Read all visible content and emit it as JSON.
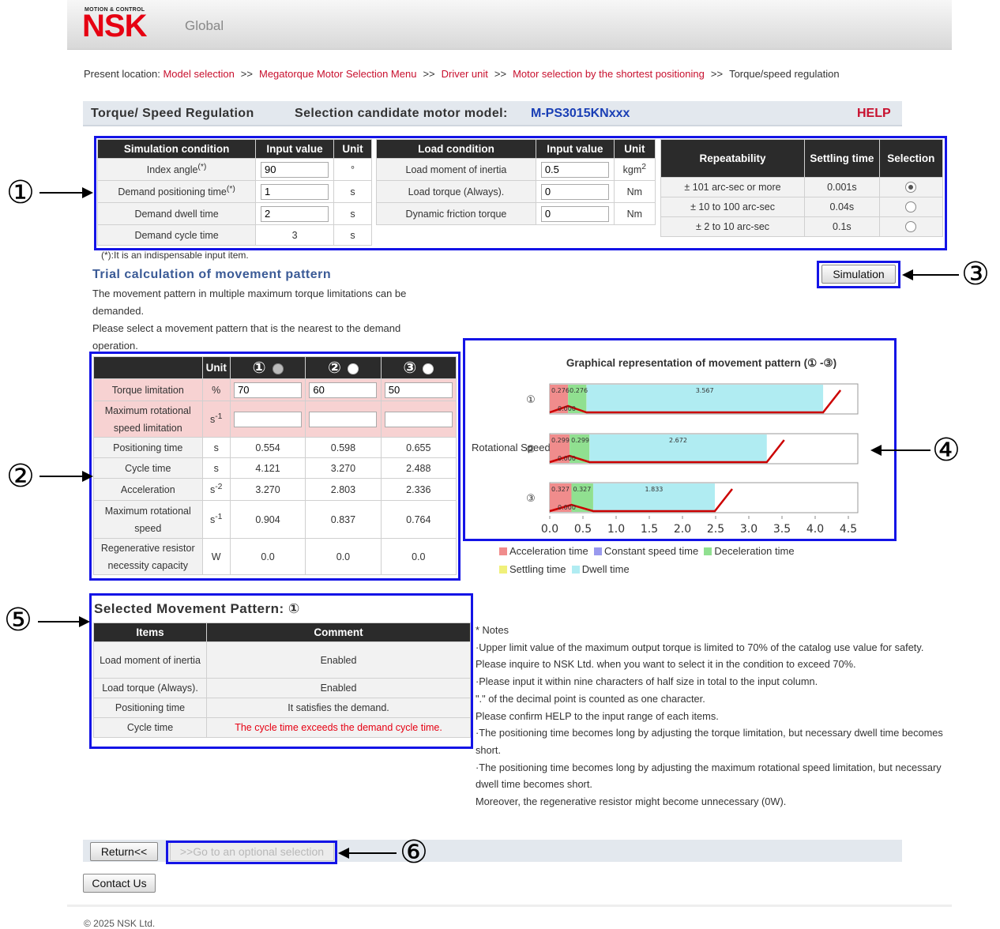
{
  "header": {
    "logo_tagline": "MOTION & CONTROL",
    "logo_text": "NSK",
    "region": "Global"
  },
  "breadcrumb": {
    "prefix": "Present location:",
    "links": [
      "Model selection",
      "Megatorque Motor Selection Menu",
      "Driver unit",
      "Motor selection by the shortest positioning"
    ],
    "separator": ">>",
    "current": "Torque/speed regulation"
  },
  "titlebar": {
    "title": "Torque/ Speed Regulation",
    "candidate_label": "Selection candidate motor model:",
    "candidate_model": "M-PS3015KNxxx",
    "help": "HELP"
  },
  "simulation_condition": {
    "headers": [
      "Simulation condition",
      "Input value",
      "Unit"
    ],
    "rows": [
      {
        "label": "Index angle",
        "mark": "(*)",
        "value": "90",
        "unit": "°",
        "input": true
      },
      {
        "label": "Demand positioning time",
        "mark": "(*)",
        "value": "1",
        "unit": "s",
        "input": true
      },
      {
        "label": "Demand dwell time",
        "mark": "",
        "value": "2",
        "unit": "s",
        "input": true
      },
      {
        "label": "Demand cycle time",
        "mark": "",
        "value": "3",
        "unit": "s",
        "input": false
      }
    ]
  },
  "load_condition": {
    "headers": [
      "Load condition",
      "Input value",
      "Unit"
    ],
    "rows": [
      {
        "label": "Load moment of inertia",
        "value": "0.5",
        "unit": "kgm",
        "unit_sup": "2"
      },
      {
        "label": "Load torque (Always).",
        "value": "0",
        "unit": "Nm",
        "unit_sup": ""
      },
      {
        "label": "Dynamic friction torque",
        "value": "0",
        "unit": "Nm",
        "unit_sup": ""
      }
    ]
  },
  "repeatability": {
    "headers": [
      "Repeatability",
      "Settling time",
      "Selection"
    ],
    "rows": [
      {
        "label": "± 101 arc-sec or more",
        "settling": "0.001s",
        "selected": true
      },
      {
        "label": "± 10 to 100 arc-sec",
        "settling": "0.04s",
        "selected": false
      },
      {
        "label": "± 2 to 10 arc-sec",
        "settling": "0.1s",
        "selected": false
      }
    ]
  },
  "indispensable_note": "(*):It is an indispensable input item.",
  "simulation_button": "Simulation",
  "trial": {
    "heading": "Trial calculation of movement pattern",
    "text1": "The movement pattern in multiple maximum torque limitations can be demanded.",
    "text2": "Please select a movement pattern that is the nearest to the demand operation."
  },
  "pattern_table": {
    "unit_header": "Unit",
    "patterns": [
      "①",
      "②",
      "③"
    ],
    "selected_index": 0,
    "rows": [
      {
        "label": "Torque limitation",
        "unit": "%",
        "unit_sup": "",
        "values": [
          "70",
          "60",
          "50"
        ],
        "input": true,
        "pink": true
      },
      {
        "label": "Maximum rotational speed limitation",
        "unit": "s",
        "unit_sup": "-1",
        "values": [
          "",
          "",
          ""
        ],
        "input": true,
        "pink": true
      },
      {
        "label": "Positioning time",
        "unit": "s",
        "unit_sup": "",
        "values": [
          "0.554",
          "0.598",
          "0.655"
        ],
        "input": false,
        "pink": false
      },
      {
        "label": "Cycle time",
        "unit": "s",
        "unit_sup": "",
        "values": [
          "4.121",
          "3.270",
          "2.488"
        ],
        "input": false,
        "pink": false
      },
      {
        "label": "Acceleration",
        "unit": "s",
        "unit_sup": "-2",
        "values": [
          "3.270",
          "2.803",
          "2.336"
        ],
        "input": false,
        "pink": false
      },
      {
        "label": "Maximum rotational speed",
        "unit": "s",
        "unit_sup": "-1",
        "values": [
          "0.904",
          "0.837",
          "0.764"
        ],
        "input": false,
        "pink": false
      },
      {
        "label": "Regenerative resistor necessity capacity",
        "unit": "W",
        "unit_sup": "",
        "values": [
          "0.0",
          "0.0",
          "0.0"
        ],
        "input": false,
        "pink": false
      }
    ]
  },
  "chart_data": {
    "type": "bar",
    "title": "Graphical representation of movement pattern (① -③)",
    "ylabel": "Rotational Speed[s⁻¹]",
    "categories": [
      "①",
      "②",
      "③"
    ],
    "xlim": [
      0,
      4.5
    ],
    "xticks": [
      "0.0",
      "0.5",
      "1.0",
      "1.5",
      "2.0",
      "2.5",
      "3.0",
      "3.5",
      "4.0",
      "4.5"
    ],
    "series": [
      {
        "name": "Acceleration time",
        "color": "#f08c8c",
        "values": [
          0.276,
          0.299,
          0.327
        ]
      },
      {
        "name": "Constant speed time",
        "color": "#9999ee",
        "values": [
          0.0,
          0.0,
          0.0
        ]
      },
      {
        "name": "Deceleration time",
        "color": "#90e090",
        "values": [
          0.276,
          0.299,
          0.327
        ]
      },
      {
        "name": "Settling time",
        "color": "#f0f07a",
        "values": [
          0.001,
          0.001,
          0.001
        ]
      },
      {
        "name": "Dwell time",
        "color": "#b0ecf2",
        "values": [
          3.567,
          2.672,
          1.833
        ]
      }
    ],
    "labels": [
      {
        "accel": "0.276",
        "const": "0.000",
        "decel": "0.276",
        "dwell": "3.567"
      },
      {
        "accel": "0.299",
        "const": "0.000",
        "decel": "0.299",
        "dwell": "2.672"
      },
      {
        "accel": "0.327",
        "const": "0.000",
        "decel": "0.327",
        "dwell": "1.833"
      }
    ]
  },
  "selected_pattern": {
    "heading": "Selected Movement Pattern:",
    "pattern": "①",
    "headers": [
      "Items",
      "Comment"
    ],
    "rows": [
      {
        "item": "Load moment of inertia",
        "comment": "Enabled",
        "warn": false
      },
      {
        "item": "Load torque (Always).",
        "comment": "Enabled",
        "warn": false
      },
      {
        "item": "Positioning time",
        "comment": "It satisfies the demand.",
        "warn": false
      },
      {
        "item": "Cycle time",
        "comment": "The cycle time exceeds the demand cycle time.",
        "warn": true
      }
    ]
  },
  "notes": {
    "title": "* Notes",
    "lines": [
      "·Upper limit value of the maximum output torque is limited to 70% of the catalog use value for safety.",
      "Please inquire to NSK Ltd. when you want to select it in the condition to exceed 70%.",
      "·Please input it within nine characters of half size in total to the input column.",
      "\".\" of the decimal point is counted as one character.",
      "Please confirm HELP to the input range of each items.",
      "·The positioning time becomes long by adjusting the torque limitation, but necessary dwell time becomes short.",
      "·The positioning time becomes long by adjusting the maximum rotational speed limitation, but necessary dwell time becomes short.",
      "Moreover, the regenerative resistor might become unnecessary (0W)."
    ]
  },
  "footer": {
    "return_button": "Return<<",
    "optional_button": ">>Go to an optional selection",
    "contact_button": "Contact Us",
    "copyright": "© 2025 NSK Ltd."
  },
  "callouts": [
    "①",
    "②",
    "③",
    "④",
    "⑤",
    "⑥"
  ],
  "colors": {
    "brand": "#e60012",
    "link": "#c8102e",
    "model": "#1a3fb5",
    "highlight_box": "#1414e6"
  }
}
